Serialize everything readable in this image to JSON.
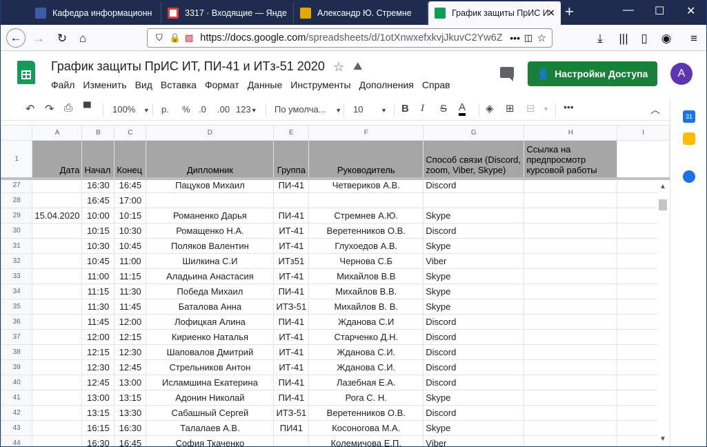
{
  "browser": {
    "tabs": [
      {
        "label": "Кафедра информационн",
        "active": false,
        "icon": "dept-icon",
        "color": "#3d5ba7"
      },
      {
        "label": "3317 · Входящие — Янде",
        "active": false,
        "icon": "mail-icon",
        "color": "#f4b400"
      },
      {
        "label": "Александр Ю. Стремне",
        "active": false,
        "icon": "outlook-icon",
        "color": "#e0a800"
      },
      {
        "label": "График защиты ПрИС И",
        "active": true,
        "icon": "sheets-icon",
        "color": "#0f9d58"
      }
    ],
    "url_domain": "https://docs.google.com",
    "url_rest": "/spreadsheets/d/1otXnwxefxkvjJkuvC2Yw6Z"
  },
  "sheet": {
    "title": "График защиты ПрИС ИТ, ПИ-41 и ИТз-51 2020",
    "menu": [
      "Файл",
      "Изменить",
      "Вид",
      "Вставка",
      "Формат",
      "Данные",
      "Инструменты",
      "Дополнения",
      "Справ"
    ],
    "share_label": "Настройки Доступа",
    "avatar_letter": "A"
  },
  "toolbar": {
    "zoom": "100%",
    "currency": "р.",
    "percent": "%",
    "dec_less": ".0",
    "dec_more": ".00",
    "format": "123",
    "font": "По умолча...",
    "font_size": "10",
    "bold": "B",
    "italic": "I",
    "strike": "S",
    "textcolor": "A"
  },
  "columns": [
    "A",
    "B",
    "C",
    "D",
    "E",
    "F",
    "G",
    "H",
    "I"
  ],
  "header_row": {
    "num": "1",
    "cells": [
      "Дата",
      "Начал",
      "Конец",
      "Дипломник",
      "Группа",
      "Руководитель",
      "Способ связи (Discord, zoom, Viber, Skype)",
      "Ссылка на предпросмотр курсовой работы",
      ""
    ]
  },
  "rows": [
    {
      "num": "27",
      "cells": [
        "",
        "16:30",
        "16:45",
        "Пацуков Михаил",
        "ПИ-41",
        "Четвериков А.В.",
        "Discord",
        ""
      ]
    },
    {
      "num": "28",
      "cells": [
        "",
        "16:45",
        "17:00",
        "",
        "",
        "",
        "",
        ""
      ]
    },
    {
      "num": "29",
      "cells": [
        "15.04.2020",
        "10:00",
        "10:15",
        "Романенко  Дарья",
        "ПИ-41",
        "Стремнев А.Ю.",
        "Skype",
        ""
      ]
    },
    {
      "num": "30",
      "cells": [
        "",
        "10:15",
        "10:30",
        "Ромащенко Н.А.",
        "ИТ-41",
        "Веретенников О.В.",
        "Discord",
        ""
      ]
    },
    {
      "num": "31",
      "cells": [
        "",
        "10:30",
        "10:45",
        "Поляков Валентин",
        "ИТ-41",
        "Глухоедов А.В.",
        "Skype",
        ""
      ]
    },
    {
      "num": "32",
      "cells": [
        "",
        "10:45",
        "11:00",
        "Шилкина С.И",
        "ИТз51",
        "Чернова С.Б",
        "Viber",
        ""
      ]
    },
    {
      "num": "33",
      "cells": [
        "",
        "11:00",
        "11:15",
        "Аладьина Анастасия",
        "ИТ-41",
        "Михайлов В.В",
        "Skype",
        ""
      ]
    },
    {
      "num": "34",
      "cells": [
        "",
        "11:15",
        "11:30",
        "Победа Михаил",
        "ПИ-41",
        "Михайлов В.В.",
        "Skype",
        ""
      ]
    },
    {
      "num": "35",
      "cells": [
        "",
        "11:30",
        "11:45",
        "Баталова Анна",
        "ИТЗ-51",
        "Михайлов В. В.",
        "Skype",
        ""
      ]
    },
    {
      "num": "36",
      "cells": [
        "",
        "11:45",
        "12:00",
        "Лофицкая Алина",
        "ПИ-41",
        "Жданова С.И",
        "Discord",
        ""
      ]
    },
    {
      "num": "37",
      "cells": [
        "",
        "12:00",
        "12:15",
        "Кириенко Наталья",
        "ИТ-41",
        "Старченко Д.Н.",
        "Discord",
        ""
      ]
    },
    {
      "num": "38",
      "cells": [
        "",
        "12:15",
        "12:30",
        "Шаповалов Дмитрий",
        "ИТ-41",
        "Жданова С.И.",
        "Discord",
        ""
      ]
    },
    {
      "num": "39",
      "cells": [
        "",
        "12:30",
        "12:45",
        "Стрельников Антон",
        "ИТ-41",
        "Жданова С.И.",
        "Discord",
        ""
      ]
    },
    {
      "num": "40",
      "cells": [
        "",
        "12:45",
        "13:00",
        "Исламшина Екатерина",
        "ПИ-41",
        "Лазебная Е.А.",
        "Discord",
        ""
      ]
    },
    {
      "num": "41",
      "cells": [
        "",
        "13:00",
        "13:15",
        "Адонин Николай",
        "ПИ-41",
        "Рога С. Н.",
        "Skype",
        ""
      ]
    },
    {
      "num": "42",
      "cells": [
        "",
        "13:15",
        "13:30",
        "Сабашный Сергей",
        "ИТЗ-51",
        "Веретенников О.В.",
        "Discord",
        ""
      ]
    },
    {
      "num": "43",
      "cells": [
        "",
        "16:15",
        "16:30",
        "Талалаев А.В.",
        "ПИ41",
        "Косоногова М.А.",
        "Skype",
        ""
      ]
    },
    {
      "num": "44",
      "cells": [
        "",
        "16:30",
        "16:45",
        "София Ткаченко",
        "",
        "Колемичова Е.П.",
        "Viber",
        ""
      ]
    }
  ]
}
